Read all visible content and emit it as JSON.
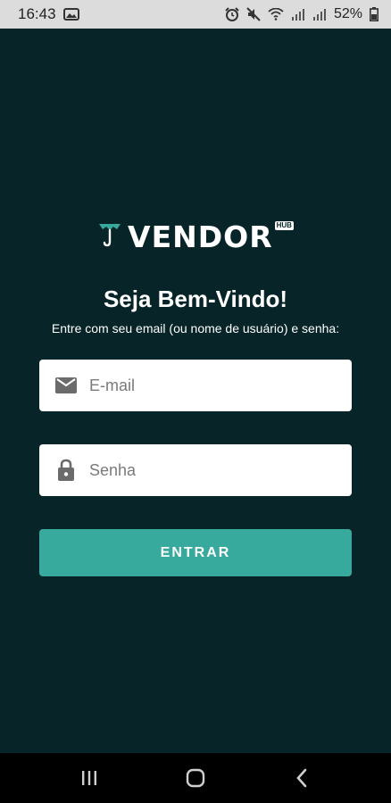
{
  "status_bar": {
    "time": "16:43",
    "battery": "52%",
    "icons": [
      "photo-icon",
      "alarm-icon",
      "mute-icon",
      "wifi-icon",
      "signal-icon",
      "signal-icon",
      "battery-icon"
    ]
  },
  "brand": {
    "name": "VENDOR",
    "badge": "HUB",
    "accent_color": "#37a99d",
    "background_color": "#072428"
  },
  "login": {
    "title": "Seja Bem-Vindo!",
    "subtitle": "Entre com seu email (ou nome de usuário) e senha:",
    "email_placeholder": "E-mail",
    "email_value": "",
    "email_icon": "mail-icon",
    "password_placeholder": "Senha",
    "password_value": "",
    "password_icon": "lock-icon",
    "submit_label": "ENTRAR"
  },
  "nav_bar": {
    "buttons": [
      "recents-icon",
      "home-icon",
      "back-icon"
    ]
  }
}
